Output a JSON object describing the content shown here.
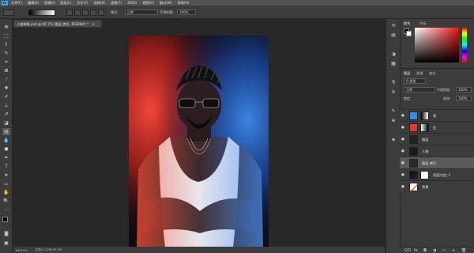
{
  "app": {
    "logo": "Ps"
  },
  "menu": [
    "文件(F)",
    "编辑(E)",
    "图像(I)",
    "图层(L)",
    "文字(Y)",
    "选择(S)",
    "滤镜(T)",
    "3D(D)",
    "视图(V)",
    "窗口(W)",
    "帮助(H)"
  ],
  "options": {
    "mode_label": "模式:",
    "mode_value": "正常",
    "opacity_label": "不透明度:",
    "opacity_value": "100%"
  },
  "document": {
    "tab_title": "人物海报.psd @ 66.7% (图层 拷贝, RGB/8#) *",
    "close": "×"
  },
  "status": {
    "zoom": "66.67%",
    "doc_info": "文档:3.12M/30.5M"
  },
  "color_panel": {
    "tabs": [
      "颜色",
      "色板"
    ]
  },
  "layers_panel": {
    "tabs": [
      "图层",
      "通道",
      "路径"
    ],
    "filter_label": "Q 类型",
    "blend_mode": "正常",
    "opacity_label": "不透明度:",
    "opacity_value": "100%",
    "lock_label": "锁定:",
    "fill_label": "填充:",
    "fill_value": "100%",
    "layers": [
      {
        "name": "青",
        "eye": "●",
        "thumb_color": "#2f8fe6",
        "has_mask": true
      },
      {
        "name": "红",
        "eye": "●",
        "thumb_color": "#e23a2e",
        "has_mask": true
      },
      {
        "name": "图层",
        "eye": "●",
        "thumb_color": "#222222",
        "has_mask": false
      },
      {
        "name": "人物",
        "eye": "●",
        "thumb_color": "#1a1a1a",
        "has_mask": false
      },
      {
        "name": "图层 拷贝",
        "eye": "●",
        "thumb_color": "#2a2a2a",
        "has_mask": false
      },
      {
        "name": "亮度/对比 1",
        "eye": "●",
        "thumb_color": "#1a1a2a",
        "has_mask": true
      },
      {
        "name": "背景",
        "eye": "●",
        "thumb_color": "#ffffff",
        "has_mask": false
      }
    ],
    "footer": [
      "GO",
      "fx",
      "◘",
      "◑",
      "▭",
      "+",
      "🗑"
    ]
  },
  "colors": {
    "accent": "#31a8ff",
    "smoke_red": "#e8342c",
    "smoke_blue": "#2f7de0"
  }
}
